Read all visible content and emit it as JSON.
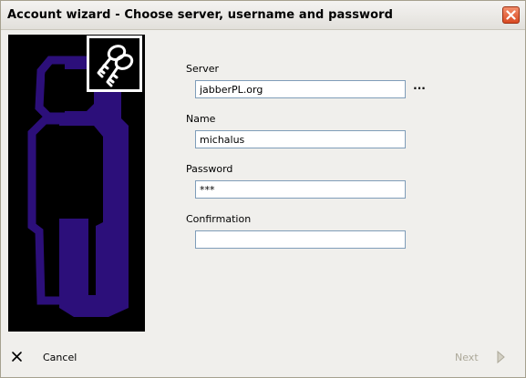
{
  "window": {
    "title": "Account wizard - Choose server, username and password"
  },
  "icons": {
    "close": "close-icon",
    "keys": "keys-icon",
    "user_silhouette": "user-silhouette-icon",
    "cancel": "x-icon",
    "next": "arrow-right-icon"
  },
  "colors": {
    "silhouette": "#2c0f7a",
    "panel_bg": "#000000",
    "close_button": "#d94a22",
    "disabled_text": "#aca899"
  },
  "form": {
    "server": {
      "label": "Server",
      "value": "jabberPL.org",
      "browse_label": "..."
    },
    "name": {
      "label": "Name",
      "value": "michalus"
    },
    "password": {
      "label": "Password",
      "value": "***"
    },
    "confirmation": {
      "label": "Confirmation",
      "value": ""
    }
  },
  "footer": {
    "cancel_label": "Cancel",
    "next_label": "Next"
  }
}
